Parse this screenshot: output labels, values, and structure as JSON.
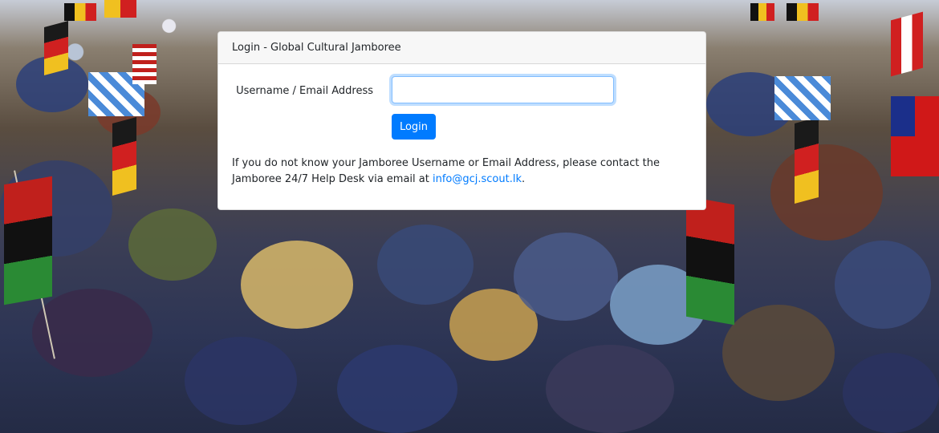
{
  "card": {
    "title": "Login - Global Cultural Jamboree",
    "username_label": "Username / Email Address",
    "username_value": "",
    "username_placeholder": "",
    "login_button": "Login",
    "help_text_before": "If you do not know your Jamboree Username or Email Address, please contact the Jamboree 24/7 Help Desk via email at ",
    "help_email": "info@gcj.scout.lk",
    "help_text_after": "."
  },
  "colors": {
    "primary": "#007bff",
    "card_header_bg": "#f7f7f7",
    "text": "#212529"
  }
}
